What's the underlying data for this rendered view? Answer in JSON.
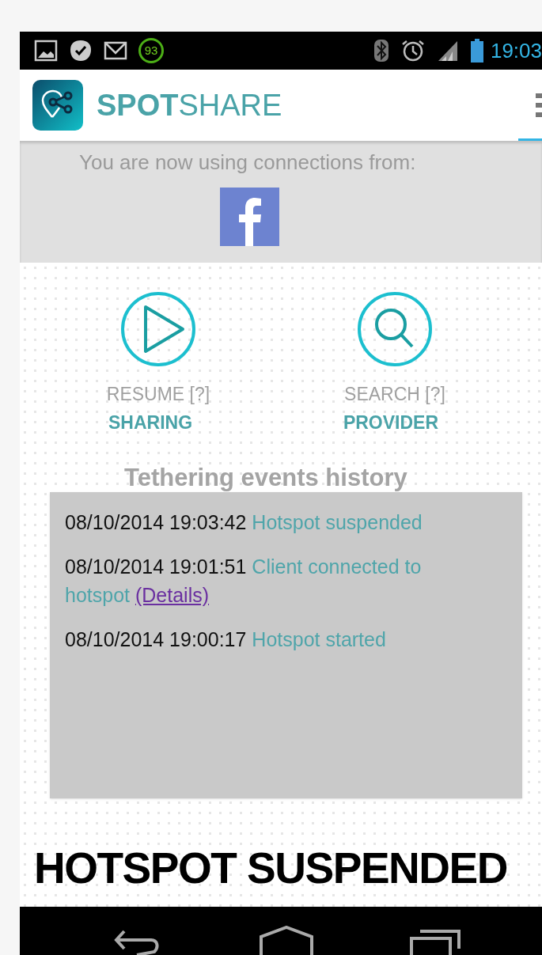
{
  "status_bar": {
    "badge": "93",
    "time": "19:03"
  },
  "app_bar": {
    "title": "**SPOT**SHARE"
  },
  "connections": {
    "label": "You are now using connections from:",
    "providers": [
      {
        "kind": "facebook"
      }
    ]
  },
  "actions": [
    {
      "kind": "play",
      "label": "RESUME [?]",
      "caption": "SHARING"
    },
    {
      "kind": "search",
      "label": "SEARCH [?]",
      "caption": "PROVIDER"
    }
  ],
  "history": {
    "title": "Tethering events history",
    "events": [
      {
        "time": "08/10/2014 19:03:42",
        "text": "Hotspot suspended"
      },
      {
        "time": "08/10/2014 19:01:51",
        "text": "Client connected to hotspot",
        "link": "(Details)"
      },
      {
        "time": "08/10/2014 19:00:17",
        "text": "Hotspot started"
      }
    ]
  },
  "status_text": "HOTSPOT SUSPENDED"
}
